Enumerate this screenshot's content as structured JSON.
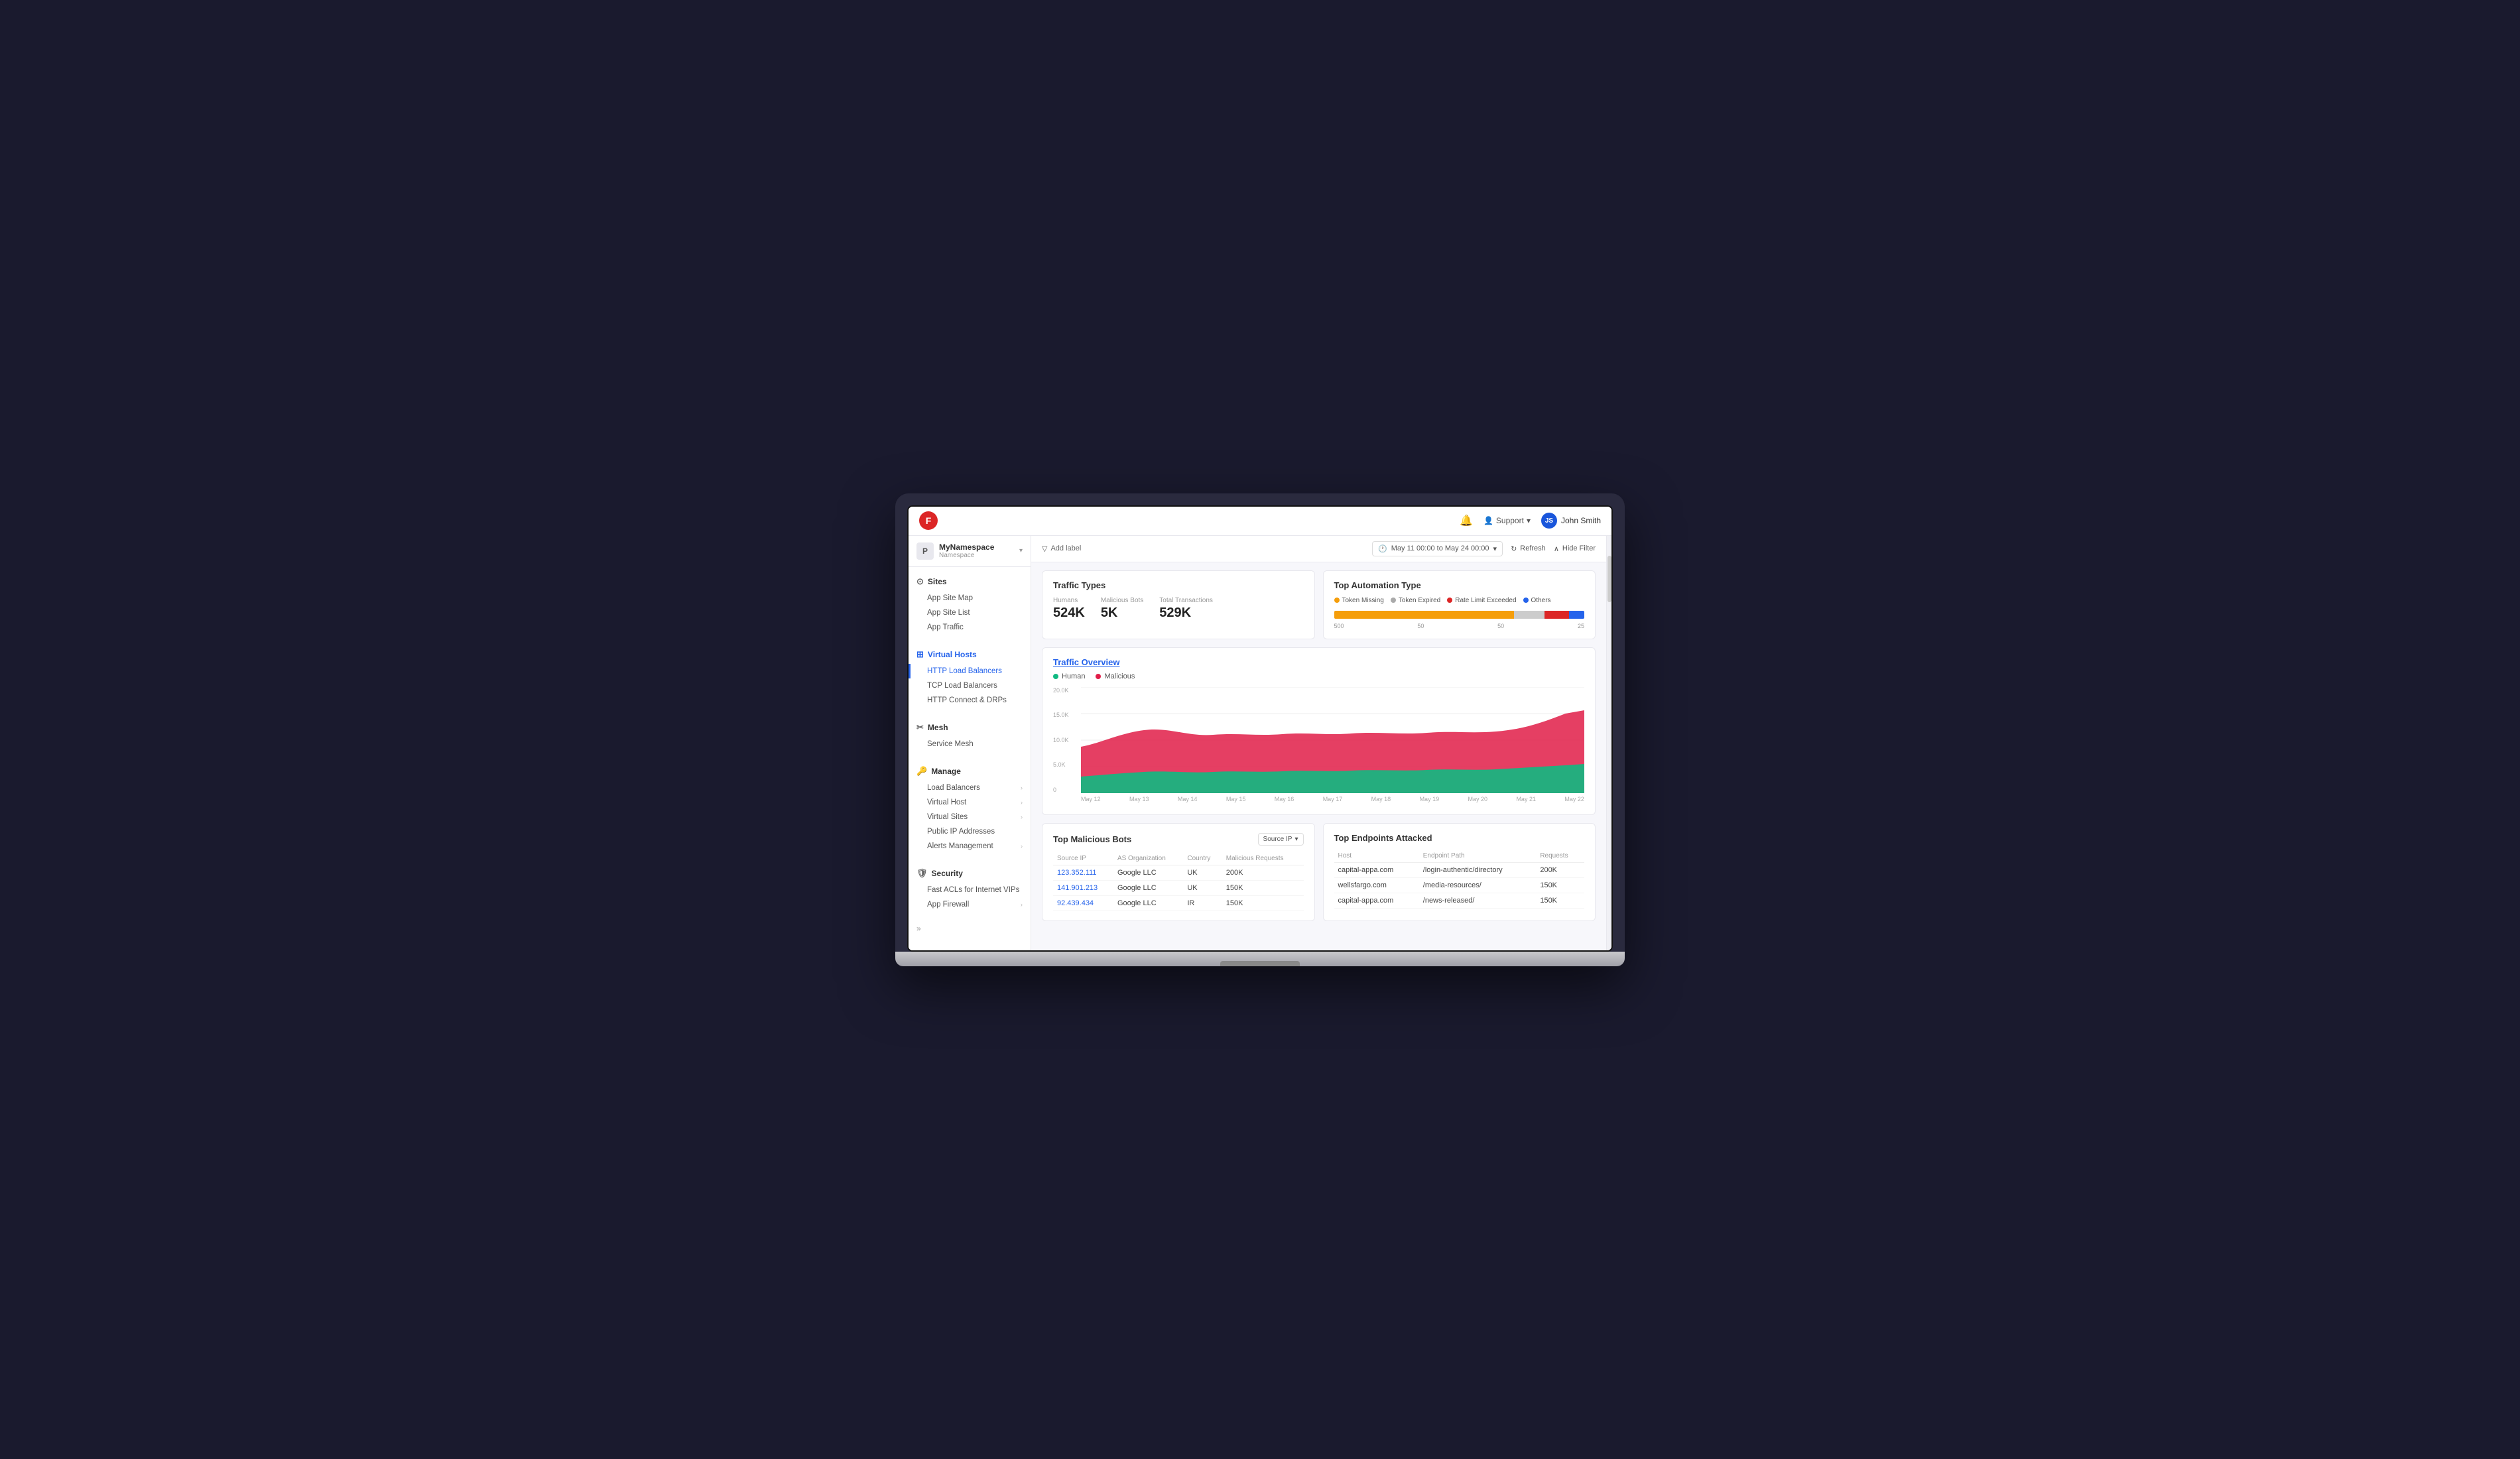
{
  "topbar": {
    "logo_text": "F",
    "bell_icon": "bell",
    "support_label": "Support",
    "user_name": "John Smith",
    "user_initials": "JS"
  },
  "sidebar": {
    "namespace": {
      "icon": "P",
      "name": "MyNamespace",
      "label": "Namespace"
    },
    "sections": [
      {
        "id": "sites",
        "icon": "⊙",
        "title": "Sites",
        "items": [
          {
            "label": "App Site Map",
            "has_chevron": false
          },
          {
            "label": "App Site List",
            "has_chevron": false
          },
          {
            "label": "App Traffic",
            "has_chevron": false
          }
        ]
      },
      {
        "id": "virtual-hosts",
        "icon": "⊞",
        "title": "Virtual Hosts",
        "items": [
          {
            "label": "HTTP Load Balancers",
            "has_chevron": false,
            "active": true
          },
          {
            "label": "TCP Load Balancers",
            "has_chevron": false
          },
          {
            "label": "HTTP Connect & DRPs",
            "has_chevron": false
          }
        ]
      },
      {
        "id": "mesh",
        "icon": "✂",
        "title": "Mesh",
        "items": [
          {
            "label": "Service Mesh",
            "has_chevron": false
          }
        ]
      },
      {
        "id": "manage",
        "icon": "🔑",
        "title": "Manage",
        "items": [
          {
            "label": "Load Balancers",
            "has_chevron": true
          },
          {
            "label": "Virtual Host",
            "has_chevron": true
          },
          {
            "label": "Virtual Sites",
            "has_chevron": true
          },
          {
            "label": "Public IP Addresses",
            "has_chevron": false
          },
          {
            "label": "Alerts Management",
            "has_chevron": true
          }
        ]
      },
      {
        "id": "security",
        "icon": "🛡",
        "title": "Security",
        "items": [
          {
            "label": "Fast ACLs for Internet VIPs",
            "has_chevron": false
          },
          {
            "label": "App Firewall",
            "has_chevron": true
          }
        ]
      }
    ],
    "expand_icon": "»"
  },
  "content": {
    "header": {
      "date_range": "May 11 00:00 to May 24 00:00",
      "refresh_label": "Refresh",
      "hide_filter_label": "Hide Filter",
      "add_label": "Add label"
    },
    "traffic_types": {
      "title": "Traffic Types",
      "humans_label": "Humans",
      "humans_value": "524K",
      "malicious_label": "Malicious Bots",
      "malicious_value": "5K",
      "total_label": "Total Transactions",
      "total_value": "529K"
    },
    "automation_type": {
      "title": "Top Automation Type",
      "legend": [
        {
          "label": "Token Missing",
          "color": "#f59e0b"
        },
        {
          "label": "Token Expired",
          "color": "#aaa"
        },
        {
          "label": "Rate Limit Exceeded",
          "color": "#dc2626"
        },
        {
          "label": "Others",
          "color": "#2563eb"
        }
      ],
      "bar_segments": [
        {
          "color": "#f59e0b",
          "width": 72
        },
        {
          "color": "#aaa",
          "width": 12
        },
        {
          "color": "#dc2626",
          "width": 10
        },
        {
          "color": "#2563eb",
          "width": 6
        }
      ],
      "bar_labels": [
        "500",
        "50",
        "50",
        "25"
      ]
    },
    "traffic_overview": {
      "title": "Traffic Overview",
      "human_label": "Human",
      "malicious_label": "Malicious",
      "human_color": "#10b981",
      "malicious_color": "#e11d48",
      "y_labels": [
        "20.0K",
        "15.0K",
        "10.0K",
        "5.0K",
        "0"
      ],
      "x_labels": [
        "May 12",
        "May 13",
        "May 14",
        "May 15",
        "May 16",
        "May 17",
        "May 18",
        "May 19",
        "May 20",
        "May 21",
        "May 22"
      ]
    },
    "malicious_bots": {
      "title": "Top Malicious Bots",
      "source_ip_label": "Source IP",
      "columns": [
        "Source IP",
        "AS Organization",
        "Country",
        "Malicious Requests"
      ],
      "rows": [
        {
          "ip": "123.352.111",
          "org": "Google LLC",
          "country": "UK",
          "requests": "200K"
        },
        {
          "ip": "141.901.213",
          "org": "Google LLC",
          "country": "UK",
          "requests": "150K"
        },
        {
          "ip": "92.439.434",
          "org": "Google LLC",
          "country": "IR",
          "requests": "150K"
        }
      ]
    },
    "endpoints_attacked": {
      "title": "Top Endpoints Attacked",
      "columns": [
        "Host",
        "Endpoint Path",
        "Requests"
      ],
      "rows": [
        {
          "host": "capital-appa.com",
          "path": "/login-authentic/directory",
          "requests": "200K"
        },
        {
          "host": "wellsfargo.com",
          "path": "/media-resources/",
          "requests": "150K"
        },
        {
          "host": "capital-appa.com",
          "path": "/news-released/",
          "requests": "150K"
        }
      ]
    }
  }
}
